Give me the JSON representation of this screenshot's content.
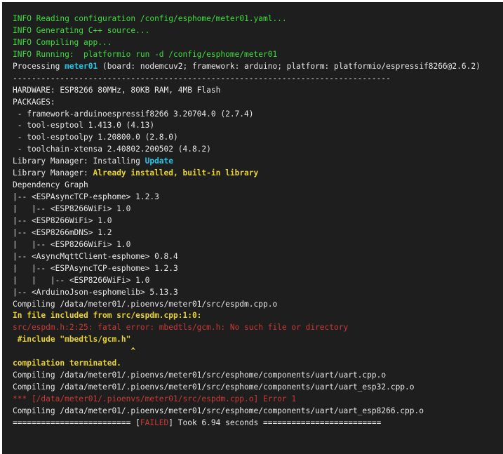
{
  "console": {
    "lines": [
      {
        "segments": [
          {
            "text": "INFO Reading configuration /config/esphome/meter01.yaml...",
            "color": "green"
          }
        ]
      },
      {
        "segments": [
          {
            "text": "INFO Generating C++ source...",
            "color": "green"
          }
        ]
      },
      {
        "segments": [
          {
            "text": "INFO Compiling app...",
            "color": "green"
          }
        ]
      },
      {
        "segments": [
          {
            "text": "INFO Running:  platformio run -d /config/esphome/meter01",
            "color": "green"
          }
        ]
      },
      {
        "segments": [
          {
            "text": "Processing ",
            "color": "white"
          },
          {
            "text": "meter01",
            "color": "cyan"
          },
          {
            "text": " (board: nodemcuv2; framework: arduino; platform: platformio/espressif8266@2.6.2)",
            "color": "white"
          }
        ]
      },
      {
        "segments": [
          {
            "text": "--------------------------------------------------------------------------------",
            "color": "white"
          }
        ]
      },
      {
        "segments": [
          {
            "text": "HARDWARE: ESP8266 80MHz, 80KB RAM, 4MB Flash",
            "color": "white"
          }
        ]
      },
      {
        "segments": [
          {
            "text": "PACKAGES:",
            "color": "white"
          }
        ]
      },
      {
        "segments": [
          {
            "text": " - framework-arduinoespressif8266 3.20704.0 (2.7.4)",
            "color": "white"
          }
        ]
      },
      {
        "segments": [
          {
            "text": " - tool-esptool 1.413.0 (4.13)",
            "color": "white"
          }
        ]
      },
      {
        "segments": [
          {
            "text": " - tool-esptoolpy 1.20800.0 (2.8.0)",
            "color": "white"
          }
        ]
      },
      {
        "segments": [
          {
            "text": " - toolchain-xtensa 2.40802.200502 (4.8.2)",
            "color": "white"
          }
        ]
      },
      {
        "segments": [
          {
            "text": "Library Manager: Installing ",
            "color": "white"
          },
          {
            "text": "Update",
            "color": "cyan"
          }
        ]
      },
      {
        "segments": [
          {
            "text": "Library Manager: ",
            "color": "white"
          },
          {
            "text": "Already installed, built-in library",
            "color": "yellow"
          }
        ]
      },
      {
        "segments": [
          {
            "text": "Dependency Graph",
            "color": "white"
          }
        ]
      },
      {
        "segments": [
          {
            "text": "|-- <ESPAsyncTCP-esphome> 1.2.3",
            "color": "white"
          }
        ]
      },
      {
        "segments": [
          {
            "text": "|   |-- <ESP8266WiFi> 1.0",
            "color": "white"
          }
        ]
      },
      {
        "segments": [
          {
            "text": "|-- <ESP8266WiFi> 1.0",
            "color": "white"
          }
        ]
      },
      {
        "segments": [
          {
            "text": "|-- <ESP8266mDNS> 1.2",
            "color": "white"
          }
        ]
      },
      {
        "segments": [
          {
            "text": "|   |-- <ESP8266WiFi> 1.0",
            "color": "white"
          }
        ]
      },
      {
        "segments": [
          {
            "text": "|-- <AsyncMqttClient-esphome> 0.8.4",
            "color": "white"
          }
        ]
      },
      {
        "segments": [
          {
            "text": "|   |-- <ESPAsyncTCP-esphome> 1.2.3",
            "color": "white"
          }
        ]
      },
      {
        "segments": [
          {
            "text": "|   |   |-- <ESP8266WiFi> 1.0",
            "color": "white"
          }
        ]
      },
      {
        "segments": [
          {
            "text": "|-- <ArduinoJson-esphomelib> 5.13.3",
            "color": "white"
          }
        ]
      },
      {
        "segments": [
          {
            "text": "Compiling /data/meter01/.pioenvs/meter01/src/espdm.cpp.o",
            "color": "white"
          }
        ]
      },
      {
        "segments": [
          {
            "text": "In file included from src/espdm.cpp:1:0:",
            "color": "yellow"
          }
        ]
      },
      {
        "segments": [
          {
            "text": "src/espdm.h:2:25: fatal error: mbedtls/gcm.h: No such file or directory",
            "color": "red"
          }
        ]
      },
      {
        "segments": [
          {
            "text": " #include \"mbedtls/gcm.h\"",
            "color": "yellow"
          }
        ]
      },
      {
        "segments": [
          {
            "text": "                         ^",
            "color": "yellow"
          }
        ]
      },
      {
        "segments": [
          {
            "text": "compilation terminated.",
            "color": "yellow"
          }
        ]
      },
      {
        "segments": [
          {
            "text": "Compiling /data/meter01/.pioenvs/meter01/src/esphome/components/uart/uart.cpp.o",
            "color": "white"
          }
        ]
      },
      {
        "segments": [
          {
            "text": "Compiling /data/meter01/.pioenvs/meter01/src/esphome/components/uart/uart_esp32.cpp.o",
            "color": "white"
          }
        ]
      },
      {
        "segments": [
          {
            "text": "*** [/data/meter01/.pioenvs/meter01/src/espdm.cpp.o] Error 1",
            "color": "red"
          }
        ]
      },
      {
        "segments": [
          {
            "text": "Compiling /data/meter01/.pioenvs/meter01/src/esphome/components/uart/uart_esp8266.cpp.o",
            "color": "white"
          }
        ]
      },
      {
        "segments": [
          {
            "text": "========================= [",
            "color": "white"
          },
          {
            "text": "FAILED",
            "color": "red"
          },
          {
            "text": "] Took 6.94 seconds =========================",
            "color": "white"
          }
        ]
      }
    ]
  },
  "colors": {
    "background": "#1e1e1e",
    "green": "#3ddc3d",
    "cyan": "#29c5e8",
    "yellow": "#e8d335",
    "red": "#c93a35",
    "white": "#e6e6e6"
  }
}
